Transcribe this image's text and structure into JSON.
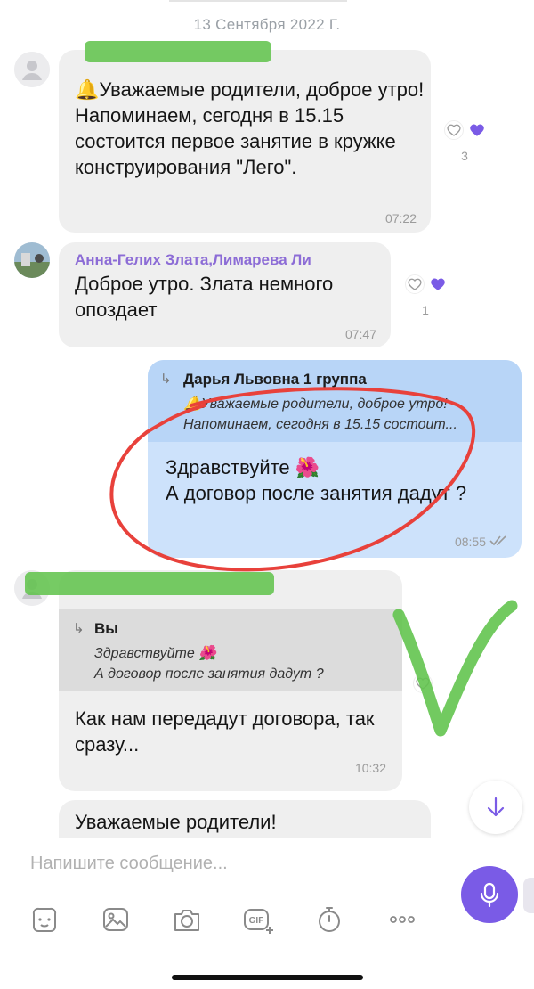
{
  "date_separator": "13 Сентября 2022 Г.",
  "messages": [
    {
      "sender": "",
      "text": "🔔Уважаемые родители, доброе утро!\nНапоминаем, сегодня в 15.15 состоится первое занятие в кружке конструирования \"Лего\".",
      "time": "07:22",
      "reaction_count": "3"
    },
    {
      "sender": "Анна-Гелих Злата,Лимарева Ли",
      "text": "Доброе утро. Злата немного опоздает",
      "time": "07:47",
      "reaction_count": "1"
    },
    {
      "reply_to": "Дарья Львовна 1 группа",
      "reply_text": "🔔Уважаемые родители, доброе утро!\nНапоминаем, сегодня в 15.15 состоит...",
      "text": "Здравствуйте 🌺\nА договор после занятия дадут ?",
      "time": "08:55"
    },
    {
      "sender": "",
      "reply_to": "Вы",
      "reply_text": "Здравствуйте 🌺\nА договор после занятия дадут ?",
      "text": "Как нам передадут договора, так сразу...",
      "time": "10:32"
    },
    {
      "sender": "",
      "text": "Уважаемые родители!"
    }
  ],
  "composer": {
    "placeholder": "Напишите сообщение..."
  },
  "toolbar": {
    "icons": [
      "sticker-icon",
      "gallery-icon",
      "camera-icon",
      "gif-icon",
      "timer-icon",
      "more-icon"
    ],
    "gif_label": "GIF"
  },
  "colors": {
    "accent": "#7a5be6",
    "incoming_bubble": "#efefef",
    "outgoing_bubble": "#cde2fb",
    "sender_name": "#8c6cd6",
    "highlight_circle": "#e8413b",
    "redaction_marker": "#63c44f"
  }
}
